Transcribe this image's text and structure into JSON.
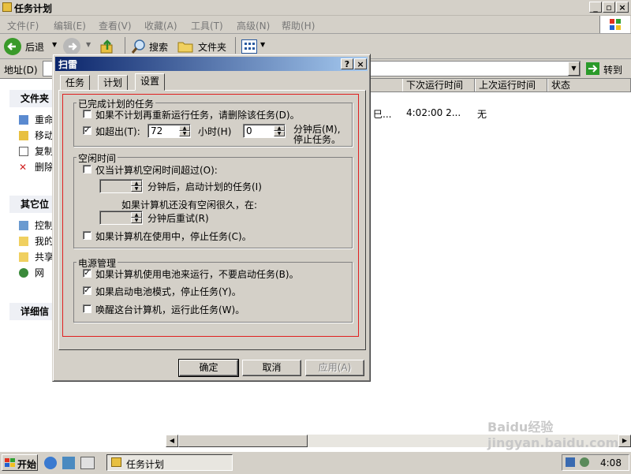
{
  "window": {
    "title": "任务计划"
  },
  "menu": [
    "文件(F)",
    "编辑(E)",
    "查看(V)",
    "收藏(A)",
    "工具(T)",
    "高级(N)",
    "帮助(H)"
  ],
  "toolbar": {
    "back": "后退",
    "search": "搜索",
    "folders": "文件夹"
  },
  "address": {
    "label": "地址(D)",
    "go": "转到"
  },
  "left_panel": {
    "file_tasks_title": "文件夹",
    "file_tasks": [
      "重命",
      "移动",
      "复制",
      "删除"
    ],
    "other_places_title": "其它位",
    "other_places": [
      "控制",
      "我的",
      "共享",
      "网"
    ],
    "details_title": "详细信"
  },
  "list": {
    "columns": [
      "下次运行时间",
      "上次运行时间",
      "状态"
    ],
    "row": {
      "col1": "巳...",
      "next_run": "4:02:00  2...",
      "last_run": "无"
    }
  },
  "dialog": {
    "title": "扫雷",
    "help_btn": "?",
    "close_btn": "×",
    "tabs": [
      "任务",
      "计划",
      "设置"
    ],
    "active_tab": "设置",
    "completed": {
      "title": "已完成计划的任务",
      "delete_if_not_scheduled": {
        "label": "如果不计划再重新运行任务，请删除该任务(D)。",
        "checked": false
      },
      "stop_if_runs": {
        "label": "如超出(T):",
        "checked": true
      },
      "hours_value": "72",
      "hours_label": "小时(H)",
      "minutes_value": "0",
      "minutes_label_1": "分钟后(M),",
      "minutes_label_2": "停止任务。"
    },
    "idle": {
      "title": "空闲时间",
      "only_if_idle": {
        "label": "仅当计算机空闲时间超过(O):",
        "checked": false
      },
      "start_after": "分钟后，启动计划的任务(I)",
      "not_idle_long": "如果计算机还没有空闲很久，在:",
      "retry_after": "分钟后重试(R)",
      "stop_if_in_use": {
        "label": "如果计算机在使用中，停止任务(C)。",
        "checked": false
      }
    },
    "power": {
      "title": "电源管理",
      "no_start_on_battery": {
        "label": "如果计算机使用电池来运行，不要启动任务(B)。",
        "checked": true
      },
      "stop_on_battery": {
        "label": "如果启动电池模式，停止任务(Y)。",
        "checked": true
      },
      "wake_to_run": {
        "label": "唤醒这台计算机，运行此任务(W)。",
        "checked": false
      }
    },
    "buttons": {
      "ok": "确定",
      "cancel": "取消",
      "apply": "应用(A)"
    }
  },
  "taskbar": {
    "start": "开始",
    "task": "任务计划",
    "clock": "4:08"
  },
  "watermark": "Baidu经验 jingyan.baidu.com"
}
